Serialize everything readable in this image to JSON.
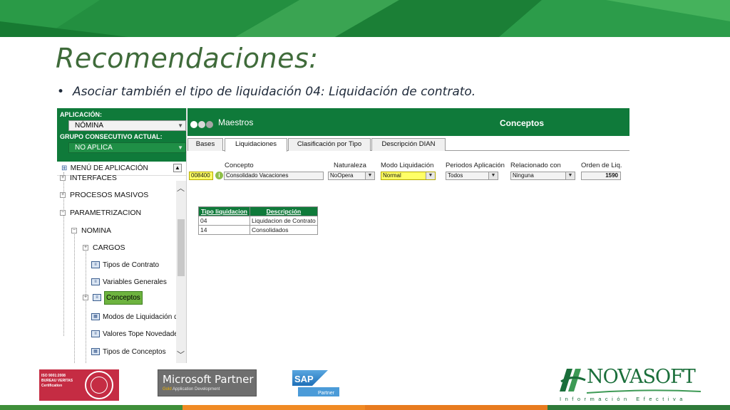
{
  "slide": {
    "title": "Recomendaciones:",
    "bullet_symbol": "•",
    "bullet_text": "Asociar también el tipo de liquidación 04: Liquidación de contrato."
  },
  "colors": {
    "brand_green": "#0f7a3a",
    "selected_green": "#6db33f",
    "highlight_yellow": "#ffff66"
  },
  "left_panel": {
    "aplicacion_label": "APLICACIÓN:",
    "aplicacion_value": "NÓMINA",
    "grupo_label": "GRUPO CONSECUTIVO ACTUAL:",
    "grupo_value": "NO APLICA",
    "menu_title": "MENÚ DE APLICACIÓN",
    "tree": [
      {
        "label": "INTERFACES",
        "icon": "plus-expander-icon"
      },
      {
        "label": "PROCESOS MASIVOS",
        "icon": "plus-expander-icon"
      },
      {
        "label": "PARAMETRIZACION",
        "icon": "minus-expander-icon"
      },
      {
        "label": "NOMINA",
        "icon": "minus-expander-icon"
      },
      {
        "label": "CARGOS",
        "icon": "plus-expander-icon"
      },
      {
        "label": "Tipos de Contrato",
        "icon": "form-icon"
      },
      {
        "label": "Variables Generales",
        "icon": "form-icon"
      },
      {
        "label": "Conceptos",
        "icon": "form-icon",
        "selected": true
      },
      {
        "label": "Modos de Liquidación de C",
        "icon": "grid-icon"
      },
      {
        "label": "Valores Tope Novedades",
        "icon": "form-icon"
      },
      {
        "label": "Tipos de Conceptos",
        "icon": "grid-icon"
      }
    ]
  },
  "right_panel": {
    "module": "Maestros",
    "title": "Conceptos",
    "tabs": [
      "Bases",
      "Liquidaciones",
      "Clasificación por Tipo",
      "Descripción DIAN"
    ],
    "active_tab": "Liquidaciones",
    "fields": {
      "concepto": {
        "label": "Concepto",
        "code": "008400",
        "value": "Consolidado Vacaciones"
      },
      "naturaleza": {
        "label": "Naturaleza",
        "value": "NoOpera"
      },
      "modo_liquidacion": {
        "label": "Modo Liquidación",
        "value": "Normal"
      },
      "periodos_aplicacion": {
        "label": "Periodos Aplicación",
        "value": "Todos"
      },
      "relacionado_con": {
        "label": "Relacionado con",
        "value": "Ninguna"
      },
      "orden_liq": {
        "label": "Orden de Liq.",
        "value": "1590"
      }
    },
    "liquidation_table": {
      "headers": [
        "Tipo liquidacion",
        "Descripción"
      ],
      "rows": [
        [
          "04",
          "Liquidacion de Contrato"
        ],
        [
          "14",
          "Consolidados"
        ]
      ]
    }
  },
  "footer": {
    "bureau_veritas": {
      "line1": "ISO 9001:2008",
      "line2": "BUREAU VERITAS",
      "line3": "Certification"
    },
    "microsoft": {
      "title": "Microsoft Partner",
      "gold": "Gold",
      "subtitle": "Application Development"
    },
    "sap": {
      "brand": "SAP",
      "sub": "Partner"
    },
    "novasoft": {
      "name": "NOVASOFT",
      "tagline": "Información Efectiva"
    }
  }
}
